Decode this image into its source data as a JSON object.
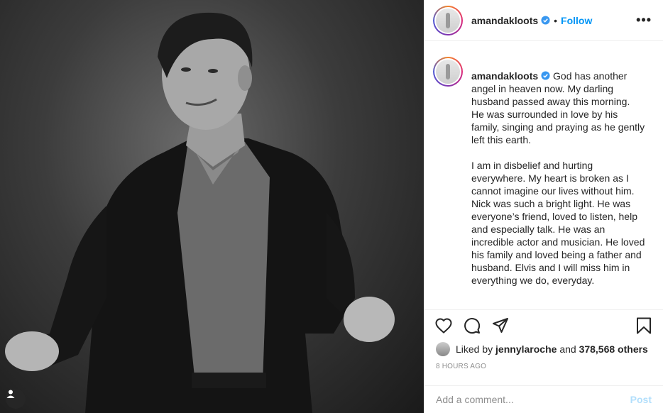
{
  "photo": {
    "alt_icon": "user-tag-icon"
  },
  "header": {
    "username": "amandakloots",
    "separator": "•",
    "follow_label": "Follow",
    "more_label": "•••"
  },
  "caption": {
    "username": "amandakloots",
    "paragraph1": "God has another angel in heaven now. My darling husband passed away this morning. He was surrounded in love by his family, singing and praying as he gently left this earth.",
    "paragraph2": "I am in disbelief and hurting everywhere. My heart is broken as I cannot imagine our lives without him. Nick was such a bright light. He was everyone’s friend, loved to listen, help and especially talk. He was an incredible actor and musician. He loved his family and loved being a father and husband. Elvis and I will miss him in everything we do, everyday."
  },
  "likes": {
    "prefix": "Liked by",
    "user": "jennylaroche",
    "middle": "and",
    "count": "378,568 others"
  },
  "timestamp": "8 HOURS AGO",
  "comment": {
    "placeholder": "Add a comment...",
    "post_label": "Post"
  },
  "colors": {
    "link": "#0095f6",
    "post_disabled": "#b2dffc",
    "muted": "#8e8e8e"
  }
}
